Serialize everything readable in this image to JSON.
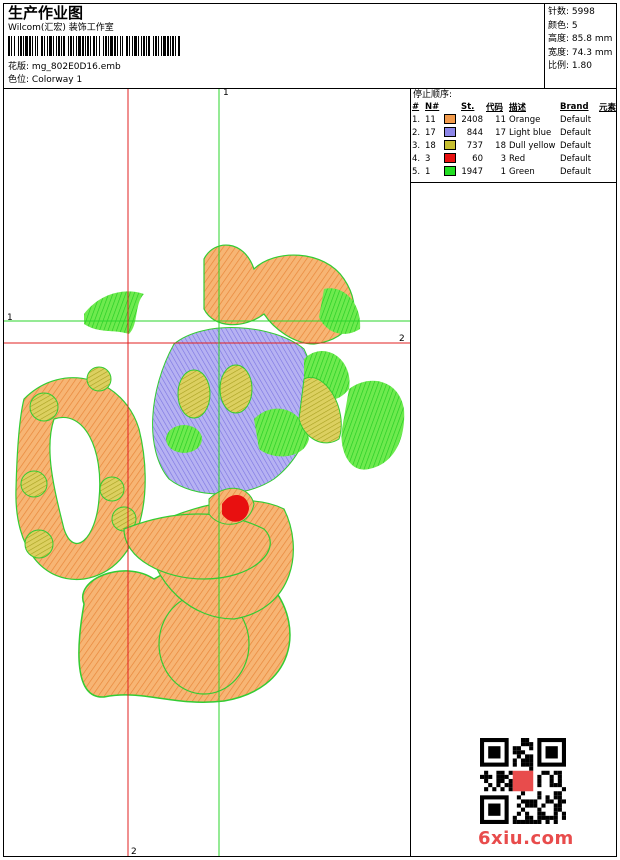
{
  "header": {
    "title": "生产作业图",
    "company": "Wilcom(汇宏) 装饰工作室",
    "design_label": "花版:",
    "design_value": "mg_802E0D16.emb",
    "colorway_label": "色位:",
    "colorway_value": "Colorway 1"
  },
  "specs": [
    {
      "label": "针数:",
      "value": "5998"
    },
    {
      "label": "颜色:",
      "value": "5"
    },
    {
      "label": "高度:",
      "value": "85.8 mm"
    },
    {
      "label": "宽度:",
      "value": "74.3 mm"
    },
    {
      "label": "比例:",
      "value": "1.80"
    }
  ],
  "stop_sequence": {
    "title": "停止顺序:",
    "headers": [
      "#",
      "N#",
      "St.",
      "代码",
      "描述",
      "Brand",
      "元素"
    ],
    "rows": [
      {
        "idx": "1.",
        "n": "11",
        "color": "#F29A4A",
        "st": "2408",
        "code": "11",
        "desc": "Orange",
        "brand": "Default"
      },
      {
        "idx": "2.",
        "n": "17",
        "color": "#8C86E8",
        "st": "844",
        "code": "17",
        "desc": "Light blue",
        "brand": "Default"
      },
      {
        "idx": "3.",
        "n": "18",
        "color": "#C8C030",
        "st": "737",
        "code": "18",
        "desc": "Dull yellow",
        "brand": "Default"
      },
      {
        "idx": "4.",
        "n": "3",
        "color": "#E81010",
        "st": "60",
        "code": "3",
        "desc": "Red",
        "brand": "Default"
      },
      {
        "idx": "5.",
        "n": "1",
        "color": "#22DD22",
        "st": "1947",
        "code": "1",
        "desc": "Green",
        "brand": "Default"
      }
    ]
  },
  "guides": {
    "h1": "1",
    "h2": "2",
    "v1": "1",
    "v2": "2"
  },
  "watermark": "6xiu.com"
}
